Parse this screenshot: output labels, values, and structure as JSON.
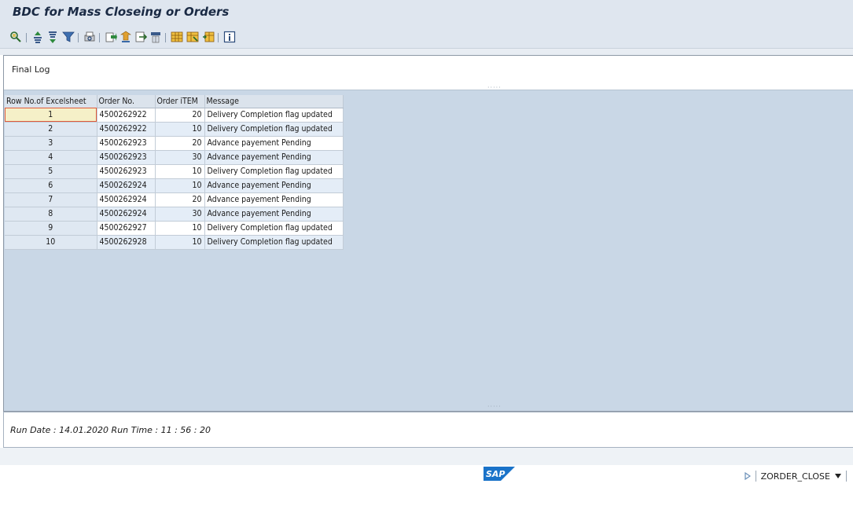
{
  "window": {
    "title": "BDC for Mass Closeing or Orders"
  },
  "toolbar": {
    "icons": [
      "detail-icon",
      "sort-ascending-icon",
      "sort-descending-icon",
      "filter-icon",
      "print-preview-icon",
      "export-icon",
      "download-icon",
      "send-icon",
      "abc-analysis-icon",
      "layout-grid-icon",
      "change-layout-icon",
      "select-layout-icon",
      "info-icon"
    ]
  },
  "heading": {
    "label": "Final Log"
  },
  "table": {
    "columns": [
      "Row No.of Excelsheet",
      "Order No.",
      "Order iTEM",
      "Message"
    ],
    "rows": [
      {
        "row": "1",
        "order": "4500262922",
        "item": "20",
        "message": "Delivery Completion flag updated"
      },
      {
        "row": "2",
        "order": "4500262922",
        "item": "10",
        "message": "Delivery Completion flag updated"
      },
      {
        "row": "3",
        "order": "4500262923",
        "item": "20",
        "message": "Advance payement Pending"
      },
      {
        "row": "4",
        "order": "4500262923",
        "item": "30",
        "message": "Advance payement Pending"
      },
      {
        "row": "5",
        "order": "4500262923",
        "item": "10",
        "message": "Delivery Completion flag updated"
      },
      {
        "row": "6",
        "order": "4500262924",
        "item": "10",
        "message": "Advance payement Pending"
      },
      {
        "row": "7",
        "order": "4500262924",
        "item": "20",
        "message": "Advance payement Pending"
      },
      {
        "row": "8",
        "order": "4500262924",
        "item": "30",
        "message": "Advance payement Pending"
      },
      {
        "row": "9",
        "order": "4500262927",
        "item": "10",
        "message": "Delivery Completion flag updated"
      },
      {
        "row": "10",
        "order": "4500262928",
        "item": "10",
        "message": "Delivery Completion flag updated"
      }
    ]
  },
  "footer": {
    "run_info": "Run Date : 14.01.2020 Run Time : 11 : 56 : 20"
  },
  "status": {
    "logo": "SAP",
    "transaction": "ZORDER_CLOSE"
  },
  "colors": {
    "selection": "#e05a3a",
    "grid_bg": "#c9d7e6",
    "title_text": "#1a2a44"
  }
}
